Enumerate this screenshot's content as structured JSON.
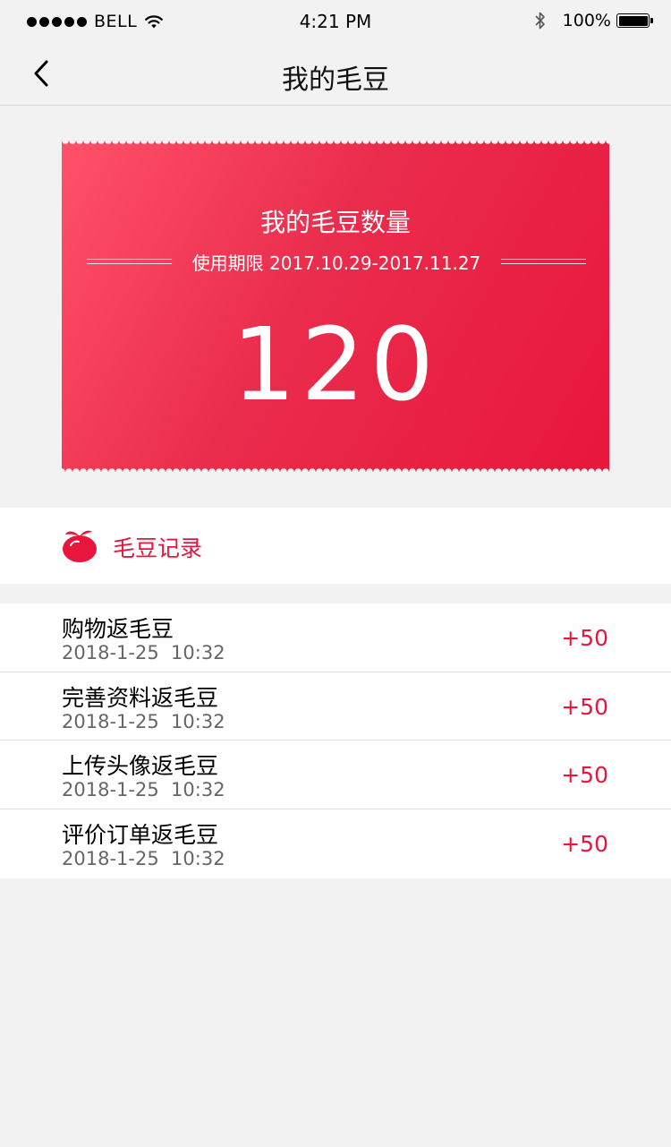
{
  "status_bar": {
    "carrier": "BELL",
    "time": "4:21 PM",
    "battery": "100%"
  },
  "nav": {
    "title": "我的毛豆"
  },
  "card": {
    "title": "我的毛豆数量",
    "period": "使用期限 2017.10.29-2017.11.27",
    "amount": "120"
  },
  "records": {
    "header": "毛豆记录",
    "items": [
      {
        "title": "购物返毛豆",
        "time": "2018-1-25  10:32",
        "points": "+50"
      },
      {
        "title": "完善资料返毛豆",
        "time": "2018-1-25  10:32",
        "points": "+50"
      },
      {
        "title": "上传头像返毛豆",
        "time": "2018-1-25  10:32",
        "points": "+50"
      },
      {
        "title": "评价订单返毛豆",
        "time": "2018-1-25  10:32",
        "points": "+50"
      }
    ]
  },
  "colors": {
    "accent": "#e8163c",
    "background": "#f2f2f2"
  },
  "icons": {
    "back": "chevron-left-icon",
    "bean": "bean-icon",
    "wifi": "wifi-icon",
    "bluetooth": "bluetooth-icon",
    "battery": "battery-icon"
  }
}
